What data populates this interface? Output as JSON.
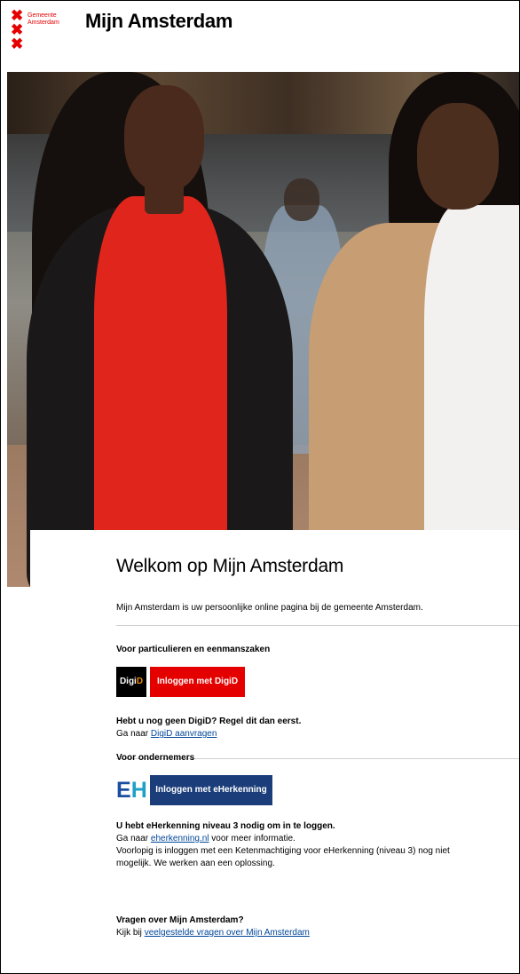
{
  "header": {
    "org_name_line1": "Gemeente",
    "org_name_line2": "Amsterdam",
    "title": "Mijn Amsterdam"
  },
  "hero": {
    "image": "two-women-walking-photo"
  },
  "main": {
    "welcome_title": "Welkom op Mijn Amsterdam",
    "intro": "Mijn Amsterdam is uw persoonlijke online pagina bij de gemeente Amsterdam.",
    "private": {
      "label": "Voor particulieren en eenmanszaken",
      "logo_text_a": "Digi",
      "logo_text_b": "D",
      "button": "Inloggen met DigiD",
      "no_digid": "Hebt u nog geen DigiD? Regel dit dan eerst.",
      "goto_prefix": "Ga naar ",
      "goto_link": "DigiD aanvragen"
    },
    "business": {
      "label": "Voor ondernemers",
      "logo_text_a": "E",
      "logo_text_b": "H",
      "button": "Inloggen met eHerkenning",
      "level_note": "U hebt eHerkenning niveau 3 nodig om in te loggen.",
      "goto_prefix": "Ga naar ",
      "goto_link": "eherkenning.nl",
      "goto_suffix": " voor meer informatie.",
      "temporary_line1": "Voorlopig is inloggen met een Ketenmachtiging voor eHerkenning (niveau 3) nog niet",
      "temporary_line2": "mogelijk. We werken aan een oplossing."
    },
    "faq": {
      "title": "Vragen over Mijn Amsterdam?",
      "prefix": "Kijk bij ",
      "link": "veelgestelde vragen over Mijn Amsterdam"
    }
  },
  "colors": {
    "brand_red": "#e50000",
    "eh_blue": "#1b3d7a",
    "link_blue": "#004699"
  }
}
